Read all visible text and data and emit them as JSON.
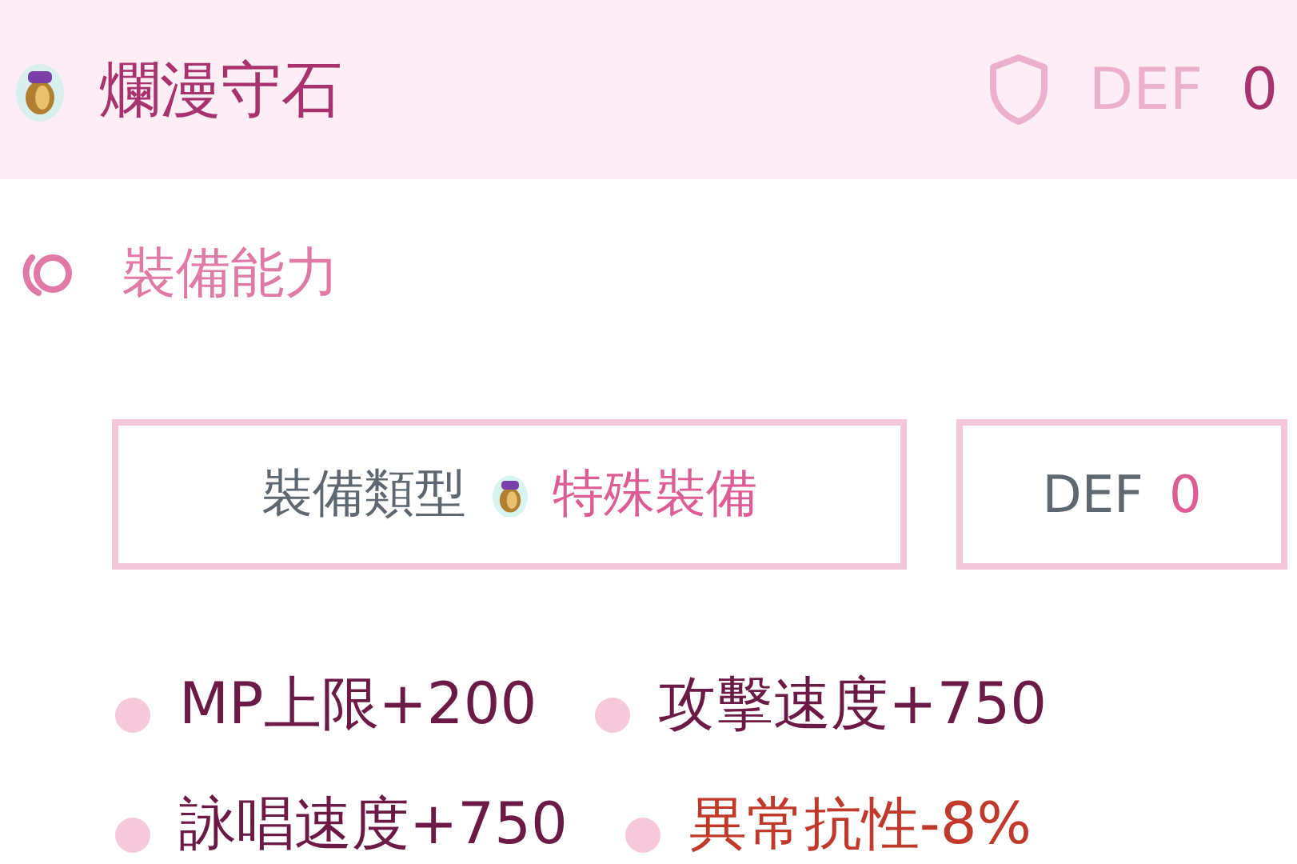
{
  "item": {
    "name": "爛漫守石",
    "def_label": "DEF",
    "def_value": "0"
  },
  "section": {
    "title": "裝備能力"
  },
  "type_box": {
    "label": "裝備類型",
    "value": "特殊裝備"
  },
  "def_box": {
    "label": "DEF",
    "value": "0"
  },
  "stats": [
    {
      "text": "MP上限+200",
      "kind": "buff"
    },
    {
      "text": "攻擊速度+750",
      "kind": "buff"
    },
    {
      "text": "詠唱速度+750",
      "kind": "buff"
    },
    {
      "text": "異常抗性-8%",
      "kind": "debuff"
    }
  ]
}
